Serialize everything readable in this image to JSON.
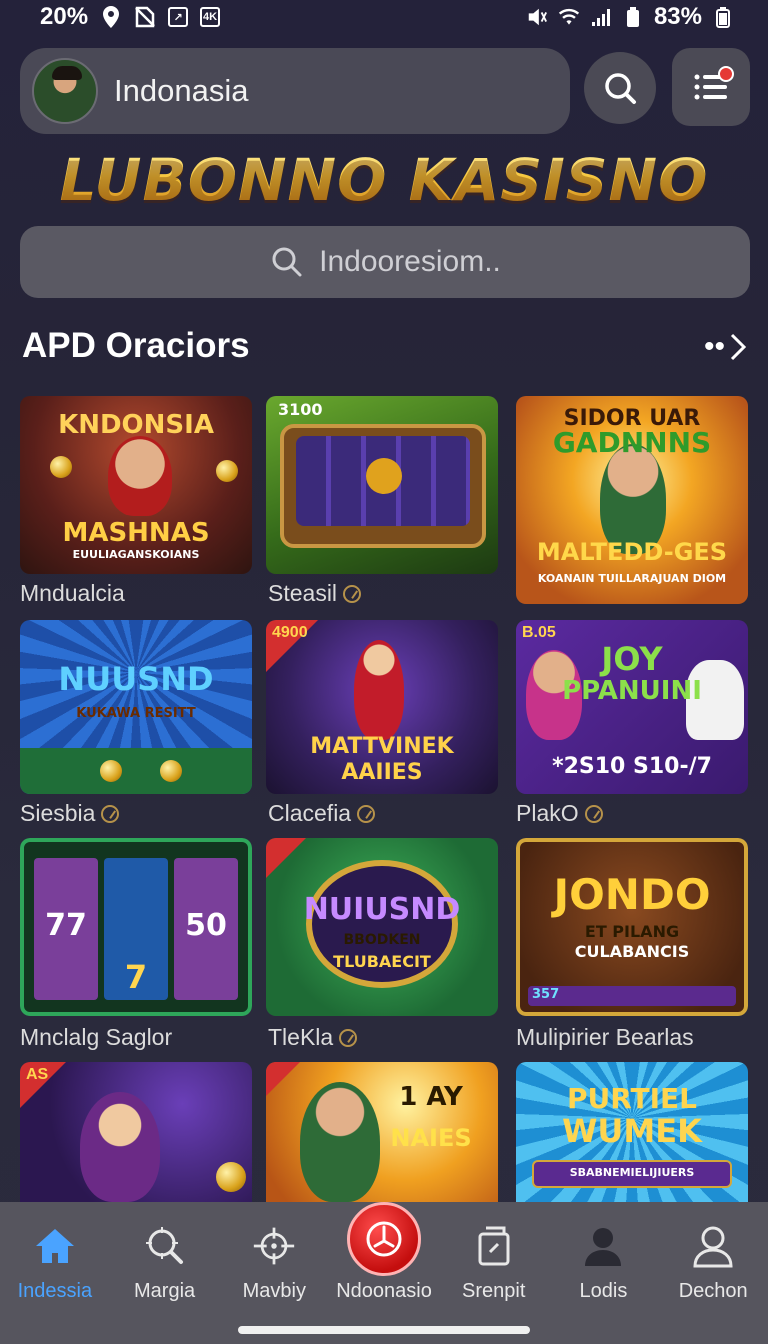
{
  "status_bar": {
    "battery_left": "20%",
    "battery_right": "83%"
  },
  "header": {
    "profile_name": "Indonasia",
    "brand_title": "LUBONNO KASISNO",
    "search_placeholder": "Indooresiom.."
  },
  "section": {
    "title": "APD Oraciors",
    "more": "••"
  },
  "games": [
    {
      "art_title": "KNDONSIA",
      "art_sub": "MASHNAS",
      "art_sub2": "EUULIAGANSKOIANS",
      "caption": "Mndualcia",
      "badge": ""
    },
    {
      "art_title": "3100",
      "art_sub": "",
      "art_sub2": "",
      "caption": "Steasil",
      "badge": ""
    },
    {
      "art_title": "SIDOR UAR",
      "art_sub": "GADNNNS",
      "art_sub2": "MALTEDD-GES",
      "art_sub3": "KOANAIN TUILLARAJUAN DIOM",
      "caption": "",
      "badge": ""
    },
    {
      "art_title": "NUUSND",
      "art_sub": "KUKAWA RESITT",
      "art_sub2": "",
      "caption": "Siesbia",
      "badge": ""
    },
    {
      "art_title": "MATTVINEK",
      "art_sub": "AAIIES",
      "art_sub2": "",
      "caption": "Clacefia",
      "badge": "4900"
    },
    {
      "art_title": "JOY",
      "art_sub": "PPANUINI",
      "art_sub2": "*2S10 S10-/7",
      "caption": "PlakO",
      "badge": "B.05"
    },
    {
      "art_title": "77",
      "art_sub": "50",
      "art_sub2": "7",
      "caption": "Mnclalg Saglor",
      "badge": ""
    },
    {
      "art_title": "NUIUSND",
      "art_sub": "BBODKEN",
      "art_sub2": "TLUBAECIT",
      "caption": "TleKla",
      "badge": ""
    },
    {
      "art_title": "JONDO",
      "art_sub": "ET PILANG",
      "art_sub2": "CULABANCIS",
      "art_sub3": "357",
      "caption": "Mulipirier Bearlas",
      "badge": ""
    },
    {
      "art_title": "",
      "art_sub": "",
      "art_sub2": "",
      "caption": "",
      "badge": "AS"
    },
    {
      "art_title": "1 AY",
      "art_sub": "NAIES",
      "art_sub2": "",
      "caption": "",
      "badge": ""
    },
    {
      "art_title": "PURTIEL",
      "art_sub": "WUMEK",
      "art_sub2": "SBABNEMIELIJIUERS",
      "caption": "",
      "badge": ""
    }
  ],
  "bottom_nav": [
    {
      "label": "Indessia",
      "icon": "home-icon"
    },
    {
      "label": "Margia",
      "icon": "search-tool-icon"
    },
    {
      "label": "Mavbiy",
      "icon": "crosshair-icon"
    },
    {
      "label": "Ndoonasio",
      "icon": "center-action-icon"
    },
    {
      "label": "Srenpit",
      "icon": "document-icon"
    },
    {
      "label": "Lodis",
      "icon": "person-filled-icon"
    },
    {
      "label": "Dechon",
      "icon": "person-outline-icon"
    }
  ],
  "colors": {
    "accent": "#4aa3ff",
    "gold": "#f7c444",
    "badge_red": "#d32f2f"
  }
}
